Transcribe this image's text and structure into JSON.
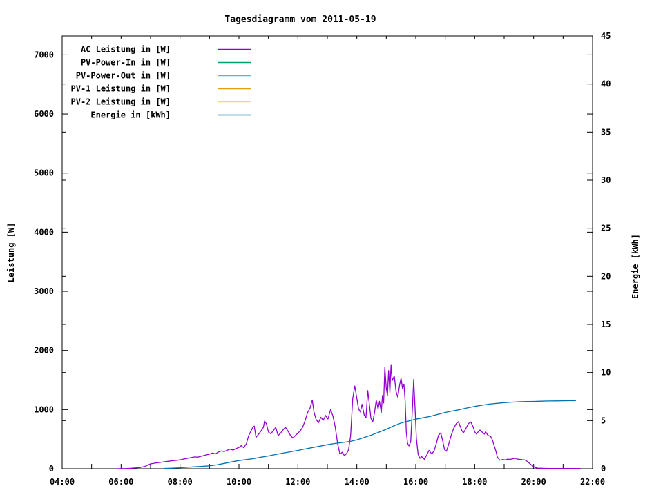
{
  "page": {
    "background": "#ffffff"
  },
  "chart_data": {
    "type": "line",
    "title": "Tagesdiagramm vom 2011-05-19",
    "grid": false,
    "legend_position": "top-left-inside",
    "x_axis": {
      "start_hour": 4,
      "end_hour": 22,
      "minor_tick_every_hours": 1,
      "major_ticks": [
        {
          "hour": 4,
          "label": "04:00"
        },
        {
          "hour": 6,
          "label": "06:00"
        },
        {
          "hour": 8,
          "label": "08:00"
        },
        {
          "hour": 10,
          "label": "10:00"
        },
        {
          "hour": 12,
          "label": "12:00"
        },
        {
          "hour": 14,
          "label": "14:00"
        },
        {
          "hour": 16,
          "label": "16:00"
        },
        {
          "hour": 18,
          "label": "18:00"
        },
        {
          "hour": 20,
          "label": "20:00"
        },
        {
          "hour": 22,
          "label": "22:00"
        }
      ]
    },
    "y_left": {
      "label": "Leistung [W]",
      "min": 0,
      "max": 7320,
      "ticks": [
        {
          "value": 0,
          "label": "0"
        },
        {
          "value": 1000,
          "label": "1000"
        },
        {
          "value": 2000,
          "label": "2000"
        },
        {
          "value": 3000,
          "label": "3000"
        },
        {
          "value": 4000,
          "label": "4000"
        },
        {
          "value": 5000,
          "label": "5000"
        },
        {
          "value": 6000,
          "label": "6000"
        },
        {
          "value": 7000,
          "label": "7000"
        }
      ]
    },
    "y_right": {
      "label": "Energie [kWh]",
      "min": 0,
      "max": 45,
      "ticks": [
        {
          "value": 0,
          "label": "0"
        },
        {
          "value": 5,
          "label": "5"
        },
        {
          "value": 10,
          "label": "10"
        },
        {
          "value": 15,
          "label": "15"
        },
        {
          "value": 20,
          "label": "20"
        },
        {
          "value": 25,
          "label": "25"
        },
        {
          "value": 30,
          "label": "30"
        },
        {
          "value": 35,
          "label": "35"
        },
        {
          "value": 40,
          "label": "40"
        },
        {
          "value": 45,
          "label": "45"
        }
      ]
    },
    "series": [
      {
        "name": "AC Leistung in [W]",
        "color": "#9400d3",
        "axis": "left",
        "points": [
          [
            5.85,
            0
          ],
          [
            6.0,
            2
          ],
          [
            6.2,
            5
          ],
          [
            6.35,
            8
          ],
          [
            6.5,
            14
          ],
          [
            6.65,
            22
          ],
          [
            6.8,
            38
          ],
          [
            7.0,
            82
          ],
          [
            7.15,
            95
          ],
          [
            7.3,
            105
          ],
          [
            7.45,
            115
          ],
          [
            7.6,
            125
          ],
          [
            7.75,
            135
          ],
          [
            7.9,
            142
          ],
          [
            8.0,
            150
          ],
          [
            8.1,
            160
          ],
          [
            8.2,
            170
          ],
          [
            8.35,
            185
          ],
          [
            8.5,
            200
          ],
          [
            8.6,
            195
          ],
          [
            8.75,
            215
          ],
          [
            8.9,
            235
          ],
          [
            9.0,
            245
          ],
          [
            9.1,
            265
          ],
          [
            9.2,
            250
          ],
          [
            9.3,
            280
          ],
          [
            9.4,
            300
          ],
          [
            9.5,
            290
          ],
          [
            9.6,
            310
          ],
          [
            9.7,
            330
          ],
          [
            9.8,
            315
          ],
          [
            9.9,
            340
          ],
          [
            10.0,
            360
          ],
          [
            10.08,
            390
          ],
          [
            10.16,
            355
          ],
          [
            10.25,
            420
          ],
          [
            10.33,
            560
          ],
          [
            10.41,
            640
          ],
          [
            10.47,
            700
          ],
          [
            10.52,
            720
          ],
          [
            10.58,
            530
          ],
          [
            10.66,
            580
          ],
          [
            10.75,
            640
          ],
          [
            10.83,
            700
          ],
          [
            10.87,
            805
          ],
          [
            10.93,
            760
          ],
          [
            11.0,
            620
          ],
          [
            11.08,
            590
          ],
          [
            11.16,
            640
          ],
          [
            11.25,
            700
          ],
          [
            11.33,
            560
          ],
          [
            11.41,
            600
          ],
          [
            11.5,
            660
          ],
          [
            11.58,
            700
          ],
          [
            11.66,
            640
          ],
          [
            11.75,
            560
          ],
          [
            11.83,
            520
          ],
          [
            11.91,
            560
          ],
          [
            12.0,
            600
          ],
          [
            12.08,
            640
          ],
          [
            12.16,
            700
          ],
          [
            12.25,
            820
          ],
          [
            12.33,
            950
          ],
          [
            12.41,
            1020
          ],
          [
            12.49,
            1160
          ],
          [
            12.55,
            950
          ],
          [
            12.62,
            830
          ],
          [
            12.7,
            780
          ],
          [
            12.78,
            870
          ],
          [
            12.86,
            820
          ],
          [
            12.94,
            900
          ],
          [
            13.02,
            840
          ],
          [
            13.11,
            1000
          ],
          [
            13.19,
            890
          ],
          [
            13.27,
            700
          ],
          [
            13.35,
            420
          ],
          [
            13.43,
            245
          ],
          [
            13.51,
            280
          ],
          [
            13.58,
            220
          ],
          [
            13.65,
            255
          ],
          [
            13.72,
            320
          ],
          [
            13.79,
            560
          ],
          [
            13.86,
            1180
          ],
          [
            13.93,
            1400
          ],
          [
            14.0,
            1190
          ],
          [
            14.06,
            1010
          ],
          [
            14.12,
            960
          ],
          [
            14.18,
            1090
          ],
          [
            14.25,
            910
          ],
          [
            14.31,
            860
          ],
          [
            14.37,
            1320
          ],
          [
            14.43,
            1070
          ],
          [
            14.48,
            850
          ],
          [
            14.54,
            790
          ],
          [
            14.6,
            950
          ],
          [
            14.66,
            1160
          ],
          [
            14.72,
            1010
          ],
          [
            14.77,
            1140
          ],
          [
            14.83,
            950
          ],
          [
            14.87,
            1240
          ],
          [
            14.91,
            1110
          ],
          [
            14.95,
            1720
          ],
          [
            15.0,
            1360
          ],
          [
            15.04,
            1240
          ],
          [
            15.08,
            1660
          ],
          [
            15.12,
            1290
          ],
          [
            15.16,
            1750
          ],
          [
            15.2,
            1490
          ],
          [
            15.27,
            1570
          ],
          [
            15.33,
            1310
          ],
          [
            15.39,
            1210
          ],
          [
            15.45,
            1410
          ],
          [
            15.5,
            1530
          ],
          [
            15.55,
            1360
          ],
          [
            15.6,
            1430
          ],
          [
            15.64,
            1150
          ],
          [
            15.68,
            620
          ],
          [
            15.72,
            430
          ],
          [
            15.77,
            385
          ],
          [
            15.83,
            455
          ],
          [
            15.89,
            1060
          ],
          [
            15.93,
            1510
          ],
          [
            15.97,
            1100
          ],
          [
            16.02,
            510
          ],
          [
            16.08,
            245
          ],
          [
            16.14,
            175
          ],
          [
            16.2,
            205
          ],
          [
            16.29,
            160
          ],
          [
            16.37,
            230
          ],
          [
            16.45,
            310
          ],
          [
            16.54,
            250
          ],
          [
            16.62,
            300
          ],
          [
            16.7,
            430
          ],
          [
            16.77,
            565
          ],
          [
            16.85,
            605
          ],
          [
            16.91,
            480
          ],
          [
            16.98,
            320
          ],
          [
            17.04,
            295
          ],
          [
            17.12,
            420
          ],
          [
            17.2,
            560
          ],
          [
            17.29,
            685
          ],
          [
            17.37,
            760
          ],
          [
            17.45,
            795
          ],
          [
            17.5,
            725
          ],
          [
            17.56,
            650
          ],
          [
            17.62,
            605
          ],
          [
            17.7,
            680
          ],
          [
            17.79,
            765
          ],
          [
            17.87,
            790
          ],
          [
            17.95,
            705
          ],
          [
            18.0,
            625
          ],
          [
            18.06,
            585
          ],
          [
            18.12,
            625
          ],
          [
            18.18,
            655
          ],
          [
            18.25,
            620
          ],
          [
            18.33,
            585
          ],
          [
            18.37,
            625
          ],
          [
            18.45,
            565
          ],
          [
            18.54,
            545
          ],
          [
            18.6,
            490
          ],
          [
            18.66,
            390
          ],
          [
            18.72,
            295
          ],
          [
            18.77,
            195
          ],
          [
            18.85,
            145
          ],
          [
            18.95,
            155
          ],
          [
            19.04,
            148
          ],
          [
            19.12,
            162
          ],
          [
            19.2,
            158
          ],
          [
            19.29,
            168
          ],
          [
            19.37,
            178
          ],
          [
            19.45,
            162
          ],
          [
            19.54,
            158
          ],
          [
            19.62,
            152
          ],
          [
            19.7,
            148
          ],
          [
            19.79,
            122
          ],
          [
            19.87,
            85
          ],
          [
            19.95,
            55
          ],
          [
            20.04,
            25
          ],
          [
            20.12,
            10
          ],
          [
            20.25,
            8
          ],
          [
            20.4,
            6
          ],
          [
            20.55,
            5
          ],
          [
            20.7,
            5
          ],
          [
            20.85,
            5
          ],
          [
            21.0,
            5
          ],
          [
            21.15,
            4
          ],
          [
            21.3,
            4
          ],
          [
            21.45,
            4
          ],
          [
            21.58,
            3
          ]
        ]
      },
      {
        "name": "PV-Power-In in [W]",
        "color": "#009e73",
        "axis": "left",
        "points": []
      },
      {
        "name": "PV-Power-Out in [W]",
        "color": "#56b4e9",
        "axis": "left",
        "points": []
      },
      {
        "name": "PV-1 Leistung in [W]",
        "color": "#e69f00",
        "axis": "left",
        "points": []
      },
      {
        "name": "PV-2 Leistung in [W]",
        "color": "#f0e442",
        "axis": "left",
        "points": []
      },
      {
        "name": "Energie in [kWh]",
        "color": "#0072b2",
        "axis": "right",
        "points": [
          [
            7.45,
            0.02
          ],
          [
            7.75,
            0.06
          ],
          [
            8.0,
            0.1
          ],
          [
            8.25,
            0.15
          ],
          [
            8.5,
            0.2
          ],
          [
            8.75,
            0.25
          ],
          [
            9.0,
            0.3
          ],
          [
            9.25,
            0.4
          ],
          [
            9.5,
            0.55
          ],
          [
            9.75,
            0.7
          ],
          [
            10.0,
            0.85
          ],
          [
            10.25,
            0.95
          ],
          [
            10.5,
            1.05
          ],
          [
            10.75,
            1.2
          ],
          [
            11.0,
            1.33
          ],
          [
            11.25,
            1.48
          ],
          [
            11.5,
            1.62
          ],
          [
            11.75,
            1.76
          ],
          [
            12.0,
            1.9
          ],
          [
            12.25,
            2.05
          ],
          [
            12.5,
            2.2
          ],
          [
            12.75,
            2.35
          ],
          [
            13.0,
            2.5
          ],
          [
            13.25,
            2.62
          ],
          [
            13.5,
            2.72
          ],
          [
            13.75,
            2.82
          ],
          [
            14.0,
            3.0
          ],
          [
            14.25,
            3.25
          ],
          [
            14.5,
            3.5
          ],
          [
            14.75,
            3.8
          ],
          [
            15.0,
            4.1
          ],
          [
            15.25,
            4.45
          ],
          [
            15.5,
            4.75
          ],
          [
            15.75,
            4.95
          ],
          [
            16.0,
            5.15
          ],
          [
            16.25,
            5.3
          ],
          [
            16.5,
            5.45
          ],
          [
            16.75,
            5.65
          ],
          [
            17.0,
            5.85
          ],
          [
            17.25,
            6.0
          ],
          [
            17.5,
            6.15
          ],
          [
            17.75,
            6.32
          ],
          [
            18.0,
            6.48
          ],
          [
            18.25,
            6.6
          ],
          [
            18.5,
            6.72
          ],
          [
            18.75,
            6.8
          ],
          [
            19.0,
            6.87
          ],
          [
            19.25,
            6.92
          ],
          [
            19.5,
            6.96
          ],
          [
            19.75,
            6.99
          ],
          [
            20.0,
            7.0
          ],
          [
            20.25,
            7.02
          ],
          [
            20.5,
            7.04
          ],
          [
            20.75,
            7.05
          ],
          [
            21.0,
            7.06
          ],
          [
            21.2,
            7.07
          ],
          [
            21.42,
            7.07
          ]
        ]
      }
    ]
  }
}
